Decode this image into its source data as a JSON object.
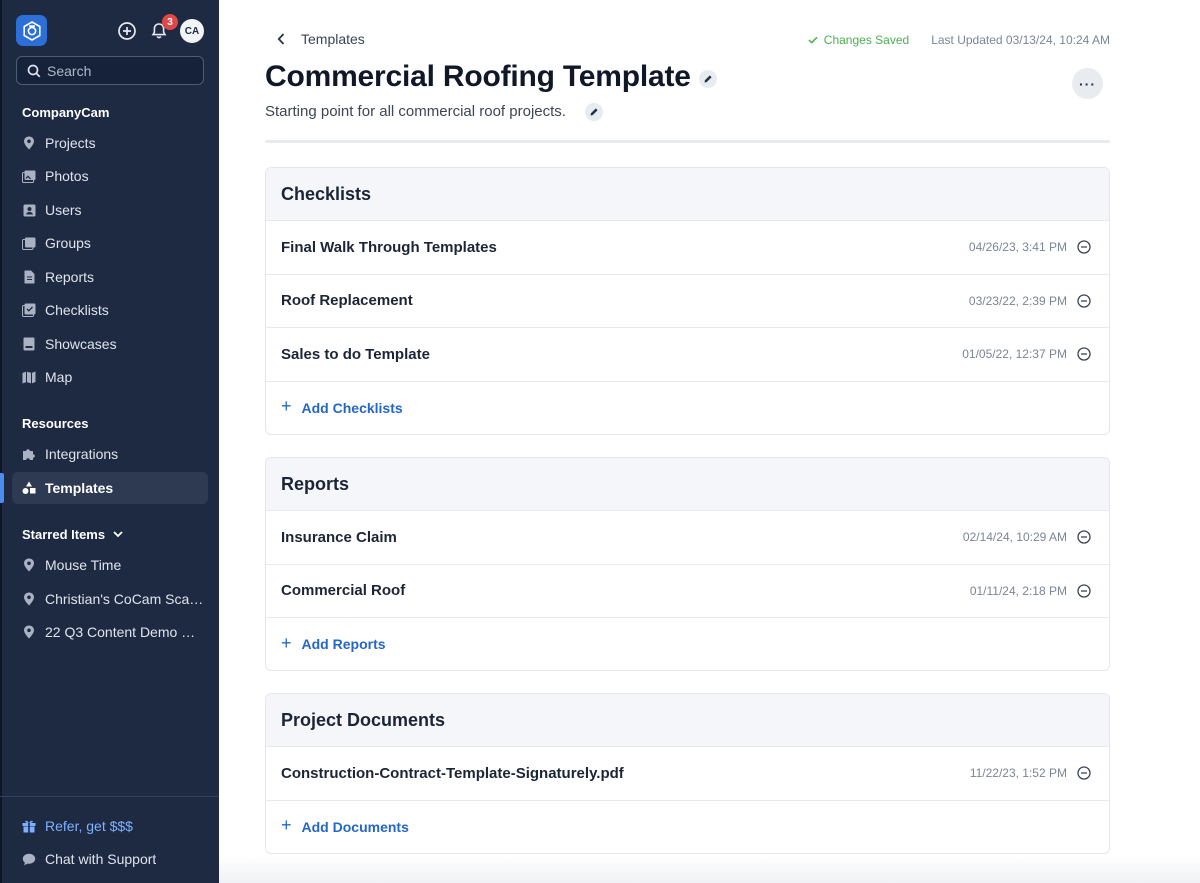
{
  "sidebar": {
    "notification_count": "3",
    "avatar_initials": "CA",
    "search_placeholder": "Search",
    "company_section": "CompanyCam",
    "company_items": [
      {
        "label": "Projects",
        "icon": "map-pin-icon"
      },
      {
        "label": "Photos",
        "icon": "photos-icon"
      },
      {
        "label": "Users",
        "icon": "user-card-icon"
      },
      {
        "label": "Groups",
        "icon": "groups-icon"
      },
      {
        "label": "Reports",
        "icon": "report-icon"
      },
      {
        "label": "Checklists",
        "icon": "checklist-icon"
      },
      {
        "label": "Showcases",
        "icon": "showcase-icon"
      },
      {
        "label": "Map",
        "icon": "map-icon"
      }
    ],
    "resources_section": "Resources",
    "resources_items": [
      {
        "label": "Integrations",
        "icon": "puzzle-icon"
      },
      {
        "label": "Templates",
        "icon": "shapes-icon",
        "active": true
      }
    ],
    "starred_section": "Starred Items",
    "starred_items": [
      {
        "label": "Mouse Time"
      },
      {
        "label": "Christian's CoCam Sca…"
      },
      {
        "label": "22 Q3 Content Demo …"
      }
    ],
    "footer_items": [
      {
        "label": "Refer, get $$$",
        "icon": "gift-icon"
      },
      {
        "label": "Chat with Support",
        "icon": "chat-icon"
      }
    ]
  },
  "header": {
    "back_label": "Templates",
    "saved_status": "Changes Saved",
    "last_updated": "Last Updated 03/13/24, 10:24 AM",
    "title": "Commercial Roofing Template",
    "subtitle": "Starting point for all commercial roof projects.",
    "more_label": "···"
  },
  "sections": {
    "checklists": {
      "title": "Checklists",
      "rows": [
        {
          "name": "Final Walk Through Templates",
          "date": "04/26/23, 3:41 PM"
        },
        {
          "name": "Roof Replacement",
          "date": "03/23/22, 2:39 PM"
        },
        {
          "name": "Sales to do Template",
          "date": "01/05/22, 12:37 PM"
        }
      ],
      "add_label": "Add Checklists"
    },
    "reports": {
      "title": "Reports",
      "rows": [
        {
          "name": "Insurance Claim",
          "date": "02/14/24, 10:29 AM"
        },
        {
          "name": "Commercial Roof",
          "date": "01/11/24, 2:18 PM"
        }
      ],
      "add_label": "Add Reports"
    },
    "documents": {
      "title": "Project Documents",
      "rows": [
        {
          "name": "Construction-Contract-Template-Signaturely.pdf",
          "date": "11/22/23, 1:52 PM"
        }
      ],
      "add_label": "Add Documents"
    }
  },
  "colors": {
    "sidebar_bg": "#1d2a42",
    "accent": "#2467c7",
    "saved_green": "#4caf50",
    "badge_red": "#e04848"
  }
}
